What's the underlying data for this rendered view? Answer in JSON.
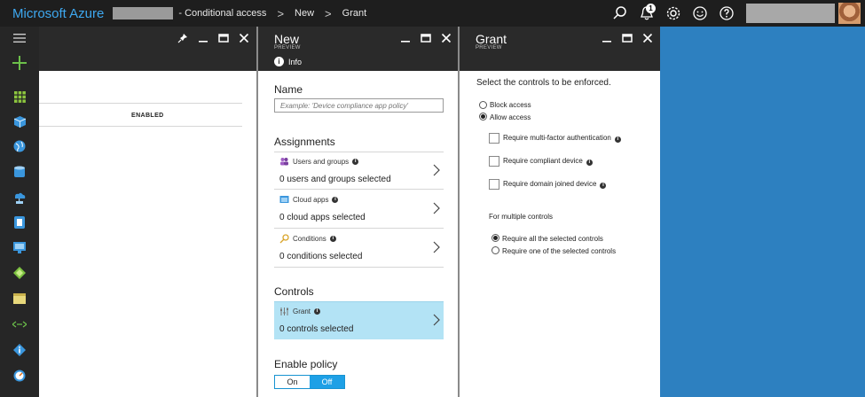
{
  "topbar": {
    "brand": "Microsoft Azure",
    "breadcrumb": [
      "- Conditional access",
      "New",
      "Grant"
    ],
    "breadcrumb_sep": ">",
    "notification_count": "1"
  },
  "left_nav": {
    "items": [
      "menu-icon",
      "new-plus-icon",
      "dashboard-icon",
      "resource-group-icon",
      "globe-icon",
      "sql-icon",
      "cloud-network-icon",
      "storage-icon",
      "monitor-icon",
      "diamond-icon",
      "panel-icon",
      "connection-icon",
      "info-diamond-icon",
      "gauge-icon"
    ]
  },
  "blade1": {
    "column_header": "ENABLED"
  },
  "blade2": {
    "title": "New",
    "subtitle": "PREVIEW",
    "info": "Info",
    "name_label": "Name",
    "name_placeholder": "Example: 'Device compliance app policy'",
    "assignments_label": "Assignments",
    "users_title": "Users and groups",
    "users_value": "0 users and groups selected",
    "apps_title": "Cloud apps",
    "apps_value": "0 cloud apps selected",
    "conditions_title": "Conditions",
    "conditions_value": "0 conditions selected",
    "controls_label": "Controls",
    "grant_title": "Grant",
    "grant_value": "0 controls selected",
    "enable_label": "Enable policy",
    "toggle_on": "On",
    "toggle_off": "Off",
    "toggle_selected": "Off"
  },
  "blade3": {
    "title": "Grant",
    "subtitle": "PREVIEW",
    "instruction": "Select the controls to be enforced.",
    "block_access": "Block access",
    "allow_access": "Allow access",
    "access_selected": "Allow access",
    "mfa": "Require multi-factor authentication",
    "compliant": "Require compliant device",
    "domain_joined": "Require domain joined device",
    "multiple_label": "For multiple controls",
    "require_all": "Require all the selected controls",
    "require_one": "Require one of the selected controls",
    "multiple_selected": "Require all the selected controls"
  },
  "colors": {
    "topbar": "#1e1e1e",
    "brand": "#3ea8f0",
    "selected_row": "#b3e3f5",
    "toggle_active": "#1ea0e6",
    "background": "#2d80c0"
  }
}
